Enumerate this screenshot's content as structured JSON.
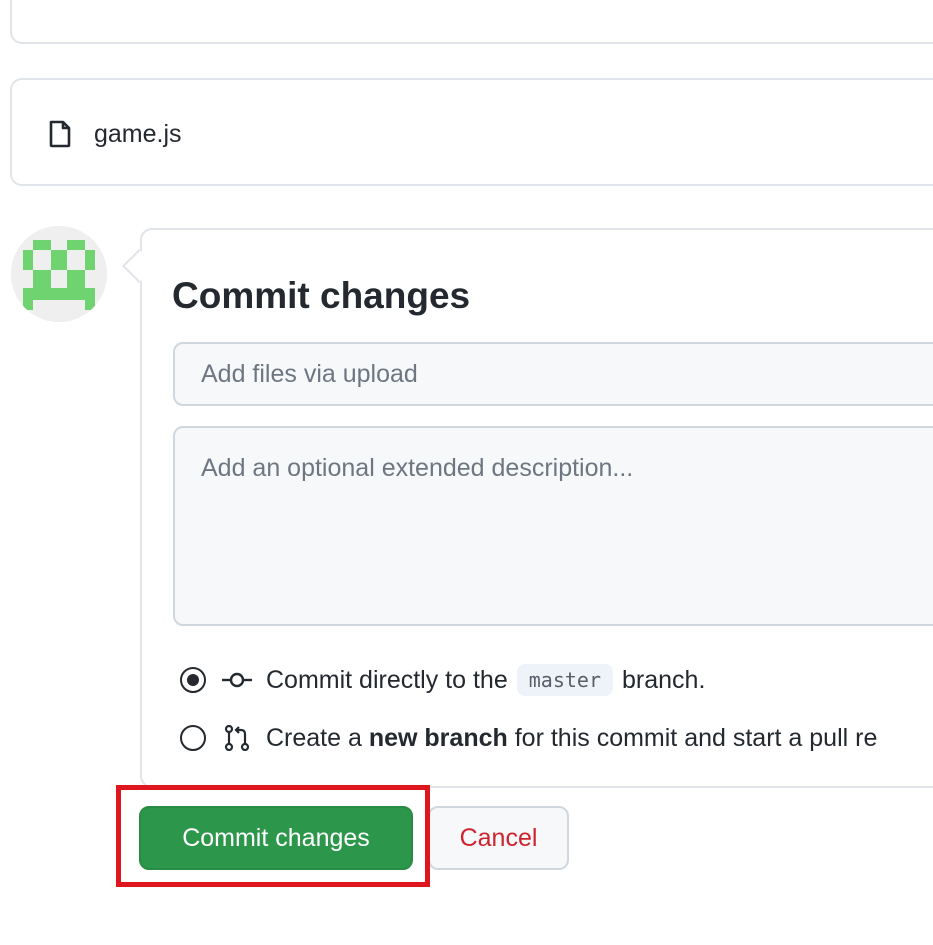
{
  "file": {
    "name": "game.js",
    "icon": "file-icon"
  },
  "avatar": {
    "icon": "identicon-avatar",
    "color": "#6fd36f"
  },
  "commit": {
    "title": "Commit changes",
    "summary_placeholder": "Add files via upload",
    "summary_value": "",
    "description_placeholder": "Add an optional extended description...",
    "description_value": "",
    "options": [
      {
        "selected": true,
        "icon": "git-commit-icon",
        "text_before": "Commit directly to the",
        "branch": "master",
        "text_after": "branch."
      },
      {
        "selected": false,
        "icon": "git-pull-request-icon",
        "text_before": "Create a",
        "bold_text": "new branch",
        "text_after": "for this commit and start a pull re"
      }
    ]
  },
  "buttons": {
    "commit_label": "Commit changes",
    "cancel_label": "Cancel"
  },
  "colors": {
    "commit_button": "#2c974b",
    "cancel_text": "#cf222e",
    "highlight": "#e0161f",
    "branch_bg": "#eef3fa"
  }
}
